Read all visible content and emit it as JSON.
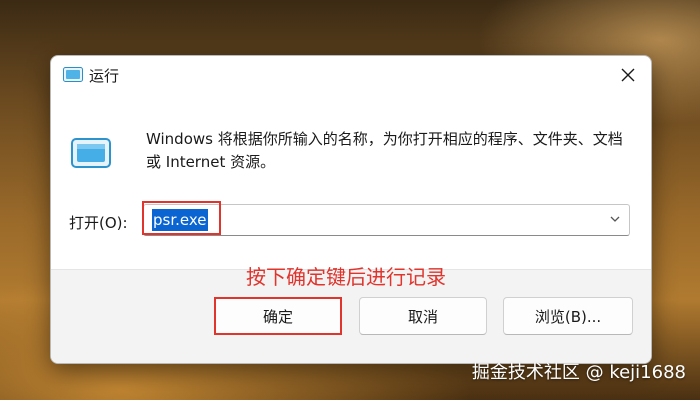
{
  "window": {
    "title": "运行"
  },
  "main": {
    "description": "Windows 将根据你所输入的名称，为你打开相应的程序、文件夹、文档或 Internet 资源。",
    "open_label": "打开(O):",
    "input_value": "psr.exe"
  },
  "annotation": "按下确定键后进行记录",
  "buttons": {
    "ok": "确定",
    "cancel": "取消",
    "browse": "浏览(B)..."
  },
  "watermark": "掘金技术社区 @ keji1688",
  "icons": {
    "app": "run-app-icon",
    "close": "close-icon",
    "dropdown": "chevron-down-icon"
  },
  "colors": {
    "highlight": "#e0342c",
    "selection": "#0a64d2"
  }
}
